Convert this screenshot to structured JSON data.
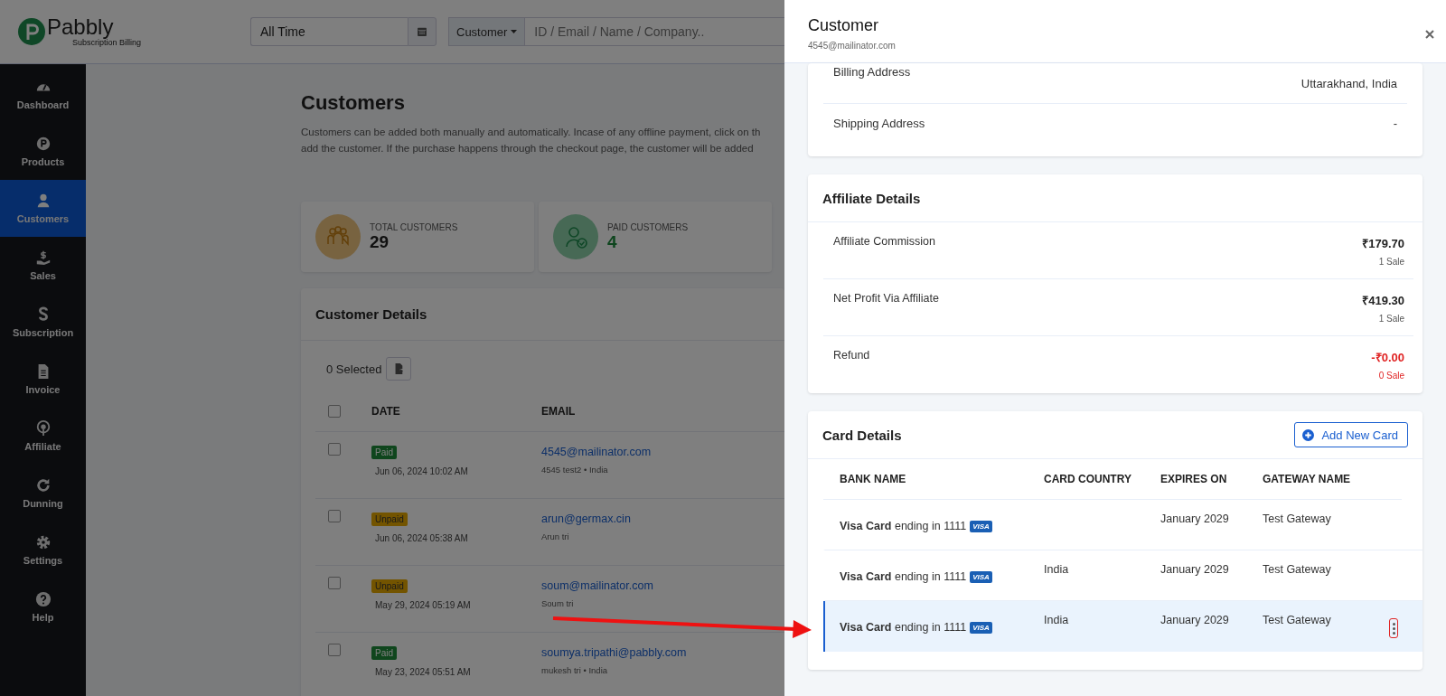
{
  "logo": {
    "name": "Pabbly",
    "tagline": "Subscription Billing"
  },
  "date_filter": {
    "value": "All Time"
  },
  "search": {
    "scope": "Customer",
    "placeholder": "ID / Email / Name / Company.."
  },
  "sidebar": {
    "items": [
      {
        "label": "Dashboard",
        "selected": false
      },
      {
        "label": "Products",
        "selected": false
      },
      {
        "label": "Customers",
        "selected": true
      },
      {
        "label": "Sales",
        "selected": false
      },
      {
        "label": "Subscription",
        "selected": false
      },
      {
        "label": "Invoice",
        "selected": false
      },
      {
        "label": "Affiliate",
        "selected": false
      },
      {
        "label": "Dunning",
        "selected": false
      },
      {
        "label": "Settings",
        "selected": false
      },
      {
        "label": "Help",
        "selected": false
      }
    ]
  },
  "page": {
    "title": "Customers",
    "description": [
      "Customers can be added both manually and automatically. Incase of any offline payment, click on th",
      "add the customer. If the purchase happens through the checkout page, the customer will be added"
    ]
  },
  "stats": [
    {
      "label": "TOTAL CUSTOMERS",
      "value": "29",
      "kind": "total",
      "color": "#786340"
    },
    {
      "label": "PAID CUSTOMERS",
      "value": "4",
      "kind": "paid",
      "color": "#476955"
    }
  ],
  "customer_table": {
    "title": "Customer Details",
    "selected_count": "0 Selected",
    "all_checked": false,
    "columns": [
      "DATE",
      "EMAIL"
    ],
    "rows": [
      {
        "checked": false,
        "status": "Paid",
        "kind": "paid",
        "date": "Jun 06, 2024 10:02 AM",
        "email": "4545@mailinator.com",
        "detail": "4545 test2 • India"
      },
      {
        "checked": false,
        "status": "Unpaid",
        "kind": "unpaid",
        "date": "Jun 06, 2024 05:38 AM",
        "email": "arun@germax.cin",
        "detail": "Arun tri"
      },
      {
        "checked": false,
        "status": "Unpaid",
        "kind": "unpaid",
        "date": "May 29, 2024 05:19 AM",
        "email": "soum@mailinator.com",
        "detail": "Soum tri"
      },
      {
        "checked": false,
        "status": "Paid",
        "kind": "paid",
        "date": "May 23, 2024 05:51 AM",
        "email": "soumya.tripathi@pabbly.com",
        "detail": "mukesh tri • India"
      }
    ]
  },
  "drawer": {
    "title": "Customer",
    "subtitle": "4545@mailinator.com",
    "address_rows": [
      {
        "label": "Billing Address",
        "value": "Uttarakhand, India"
      },
      {
        "label": "Shipping Address",
        "value": "-"
      }
    ],
    "affiliate": {
      "title": "Affiliate Details",
      "rows": [
        {
          "label": "Affiliate Commission",
          "value": "₹179.70",
          "note": "1 Sale",
          "kind": "normal"
        },
        {
          "label": "Net Profit Via Affiliate",
          "value": "₹419.30",
          "note": "1 Sale",
          "kind": "normal"
        },
        {
          "label": "Refund",
          "value": "-₹0.00",
          "note": "0 Sale",
          "kind": "negative"
        }
      ]
    },
    "cards": {
      "title": "Card Details",
      "add_button": "Add New Card",
      "columns": [
        "BANK NAME",
        "CARD COUNTRY",
        "EXPIRES ON",
        "GATEWAY NAME"
      ],
      "rows": [
        {
          "bank": "**Visa Card** ending in 1111",
          "logo": "VISA",
          "expires": "January 2029",
          "gateway": "Test Gateway",
          "selected": false
        },
        {
          "bank": "**Visa Card** ending in 1111",
          "logo": "VISA",
          "country": "India",
          "expires": "January 2029",
          "gateway": "Test Gateway",
          "selected": false
        },
        {
          "bank": "**Visa Card** ending in 1111",
          "logo": "VISA",
          "country": "India",
          "expires": "January 2029",
          "gateway": "Test Gateway",
          "selected": true
        }
      ]
    }
  },
  "annotations": [
    {
      "kind": "arrow"
    }
  ]
}
